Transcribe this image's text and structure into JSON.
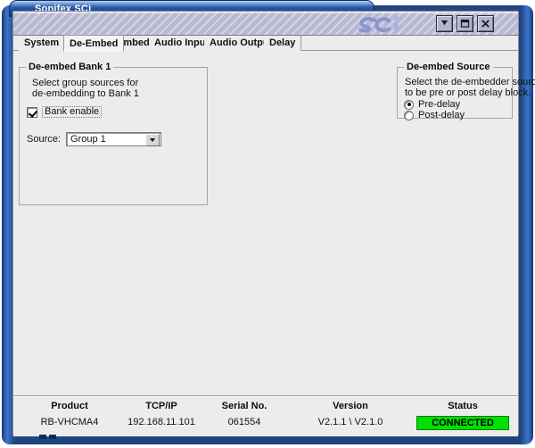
{
  "window": {
    "title": "Sonifex SCi",
    "logo_text": "sci",
    "controls": [
      {
        "name": "minimize-button",
        "glyph": "minimize"
      },
      {
        "name": "restore-button",
        "glyph": "restore"
      },
      {
        "name": "close-button",
        "glyph": "close"
      }
    ]
  },
  "tabs": [
    {
      "label": "System",
      "selected": false
    },
    {
      "label": "De-Embed",
      "selected": true
    },
    {
      "label": "Embed",
      "selected": false
    },
    {
      "label": "Audio Inputs",
      "selected": false
    },
    {
      "label": "Audio Outputs",
      "selected": false
    },
    {
      "label": "Delay",
      "selected": false
    }
  ],
  "deembed_bank": {
    "title": "De-embed Bank 1",
    "desc_line1": "Select group sources for",
    "desc_line2": "de-embedding to Bank 1",
    "checkbox": {
      "label": "Bank enable",
      "checked": true
    },
    "source": {
      "label": "Source:",
      "value": "Group 1"
    }
  },
  "deembed_source": {
    "title": "De-embed Source",
    "desc_line1": "Select the de-embedder source",
    "desc_line2": "to be pre or post delay block.",
    "options": [
      {
        "label": "Pre-delay",
        "selected": true
      },
      {
        "label": "Post-delay",
        "selected": false
      }
    ]
  },
  "status": {
    "columns": [
      {
        "header": "Product",
        "value": "RB-VHCMA4"
      },
      {
        "header": "TCP/IP",
        "value": "192.168.11.101"
      },
      {
        "header": "Serial No.",
        "value": "061554"
      },
      {
        "header": "Version",
        "value": "V2.1.1 \\ V2.1.0"
      }
    ],
    "status_header": "Status",
    "status_value": "CONNECTED",
    "status_color": "#00e000"
  }
}
